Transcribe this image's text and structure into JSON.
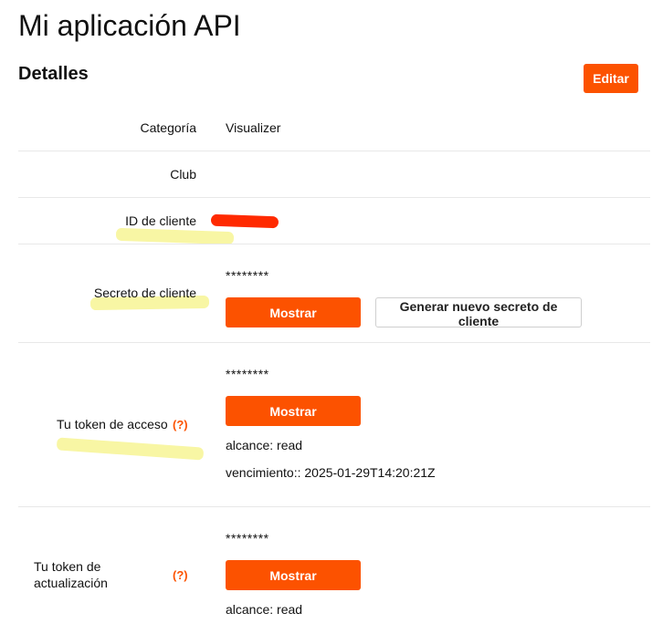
{
  "page": {
    "title": "Mi aplicación API"
  },
  "details": {
    "heading": "Detalles",
    "edit_label": "Editar"
  },
  "rows": {
    "category": {
      "label": "Categoría",
      "value": "Visualizer"
    },
    "club": {
      "label": "Club",
      "value": ""
    },
    "client_id": {
      "label": "ID de cliente"
    },
    "client_secret": {
      "label": "Secreto de cliente",
      "masked": "********",
      "show_label": "Mostrar",
      "regenerate_label": "Generar nuevo secreto de cliente"
    },
    "access_token": {
      "label": "Tu token de acceso",
      "help": "(?)",
      "masked": "********",
      "show_label": "Mostrar",
      "scope": "alcance: read",
      "expiry": "vencimiento:: 2025-01-29T14:20:21Z"
    },
    "refresh_token": {
      "label_line1": "Tu token de",
      "label_line2": "actualización",
      "help": "(?)",
      "masked": "********",
      "show_label": "Mostrar",
      "scope": "alcance: read"
    }
  },
  "colors": {
    "accent": "#fc5200",
    "highlight": "#f7f59a",
    "redaction": "#ff2a00"
  }
}
